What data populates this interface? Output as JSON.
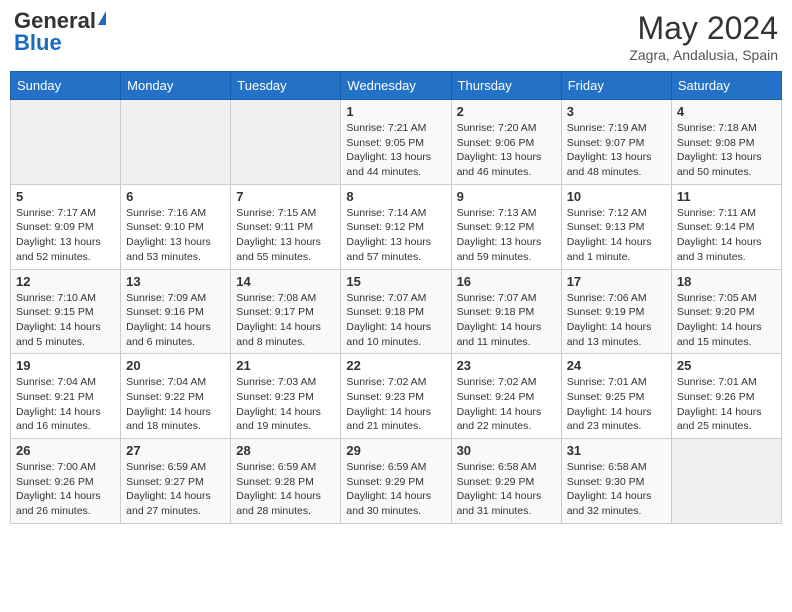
{
  "header": {
    "logo_general": "General",
    "logo_blue": "Blue",
    "month_year": "May 2024",
    "location": "Zagra, Andalusia, Spain"
  },
  "weekdays": [
    "Sunday",
    "Monday",
    "Tuesday",
    "Wednesday",
    "Thursday",
    "Friday",
    "Saturday"
  ],
  "weeks": [
    [
      {
        "day": "",
        "info": ""
      },
      {
        "day": "",
        "info": ""
      },
      {
        "day": "",
        "info": ""
      },
      {
        "day": "1",
        "info": "Sunrise: 7:21 AM\nSunset: 9:05 PM\nDaylight: 13 hours\nand 44 minutes."
      },
      {
        "day": "2",
        "info": "Sunrise: 7:20 AM\nSunset: 9:06 PM\nDaylight: 13 hours\nand 46 minutes."
      },
      {
        "day": "3",
        "info": "Sunrise: 7:19 AM\nSunset: 9:07 PM\nDaylight: 13 hours\nand 48 minutes."
      },
      {
        "day": "4",
        "info": "Sunrise: 7:18 AM\nSunset: 9:08 PM\nDaylight: 13 hours\nand 50 minutes."
      }
    ],
    [
      {
        "day": "5",
        "info": "Sunrise: 7:17 AM\nSunset: 9:09 PM\nDaylight: 13 hours\nand 52 minutes."
      },
      {
        "day": "6",
        "info": "Sunrise: 7:16 AM\nSunset: 9:10 PM\nDaylight: 13 hours\nand 53 minutes."
      },
      {
        "day": "7",
        "info": "Sunrise: 7:15 AM\nSunset: 9:11 PM\nDaylight: 13 hours\nand 55 minutes."
      },
      {
        "day": "8",
        "info": "Sunrise: 7:14 AM\nSunset: 9:12 PM\nDaylight: 13 hours\nand 57 minutes."
      },
      {
        "day": "9",
        "info": "Sunrise: 7:13 AM\nSunset: 9:12 PM\nDaylight: 13 hours\nand 59 minutes."
      },
      {
        "day": "10",
        "info": "Sunrise: 7:12 AM\nSunset: 9:13 PM\nDaylight: 14 hours\nand 1 minute."
      },
      {
        "day": "11",
        "info": "Sunrise: 7:11 AM\nSunset: 9:14 PM\nDaylight: 14 hours\nand 3 minutes."
      }
    ],
    [
      {
        "day": "12",
        "info": "Sunrise: 7:10 AM\nSunset: 9:15 PM\nDaylight: 14 hours\nand 5 minutes."
      },
      {
        "day": "13",
        "info": "Sunrise: 7:09 AM\nSunset: 9:16 PM\nDaylight: 14 hours\nand 6 minutes."
      },
      {
        "day": "14",
        "info": "Sunrise: 7:08 AM\nSunset: 9:17 PM\nDaylight: 14 hours\nand 8 minutes."
      },
      {
        "day": "15",
        "info": "Sunrise: 7:07 AM\nSunset: 9:18 PM\nDaylight: 14 hours\nand 10 minutes."
      },
      {
        "day": "16",
        "info": "Sunrise: 7:07 AM\nSunset: 9:18 PM\nDaylight: 14 hours\nand 11 minutes."
      },
      {
        "day": "17",
        "info": "Sunrise: 7:06 AM\nSunset: 9:19 PM\nDaylight: 14 hours\nand 13 minutes."
      },
      {
        "day": "18",
        "info": "Sunrise: 7:05 AM\nSunset: 9:20 PM\nDaylight: 14 hours\nand 15 minutes."
      }
    ],
    [
      {
        "day": "19",
        "info": "Sunrise: 7:04 AM\nSunset: 9:21 PM\nDaylight: 14 hours\nand 16 minutes."
      },
      {
        "day": "20",
        "info": "Sunrise: 7:04 AM\nSunset: 9:22 PM\nDaylight: 14 hours\nand 18 minutes."
      },
      {
        "day": "21",
        "info": "Sunrise: 7:03 AM\nSunset: 9:23 PM\nDaylight: 14 hours\nand 19 minutes."
      },
      {
        "day": "22",
        "info": "Sunrise: 7:02 AM\nSunset: 9:23 PM\nDaylight: 14 hours\nand 21 minutes."
      },
      {
        "day": "23",
        "info": "Sunrise: 7:02 AM\nSunset: 9:24 PM\nDaylight: 14 hours\nand 22 minutes."
      },
      {
        "day": "24",
        "info": "Sunrise: 7:01 AM\nSunset: 9:25 PM\nDaylight: 14 hours\nand 23 minutes."
      },
      {
        "day": "25",
        "info": "Sunrise: 7:01 AM\nSunset: 9:26 PM\nDaylight: 14 hours\nand 25 minutes."
      }
    ],
    [
      {
        "day": "26",
        "info": "Sunrise: 7:00 AM\nSunset: 9:26 PM\nDaylight: 14 hours\nand 26 minutes."
      },
      {
        "day": "27",
        "info": "Sunrise: 6:59 AM\nSunset: 9:27 PM\nDaylight: 14 hours\nand 27 minutes."
      },
      {
        "day": "28",
        "info": "Sunrise: 6:59 AM\nSunset: 9:28 PM\nDaylight: 14 hours\nand 28 minutes."
      },
      {
        "day": "29",
        "info": "Sunrise: 6:59 AM\nSunset: 9:29 PM\nDaylight: 14 hours\nand 30 minutes."
      },
      {
        "day": "30",
        "info": "Sunrise: 6:58 AM\nSunset: 9:29 PM\nDaylight: 14 hours\nand 31 minutes."
      },
      {
        "day": "31",
        "info": "Sunrise: 6:58 AM\nSunset: 9:30 PM\nDaylight: 14 hours\nand 32 minutes."
      },
      {
        "day": "",
        "info": ""
      }
    ]
  ]
}
